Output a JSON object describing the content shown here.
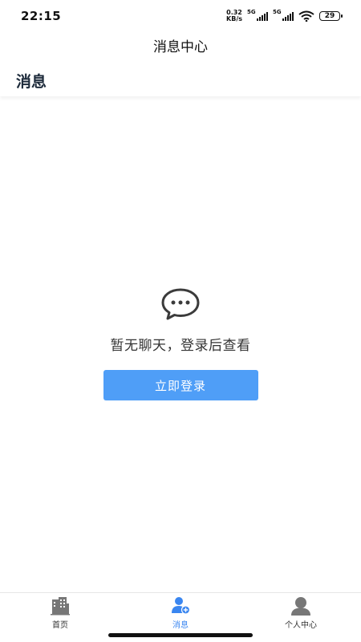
{
  "status_bar": {
    "time": "22:15",
    "net_speed_value": "0.32",
    "net_speed_unit": "KB/s",
    "sim1_label": "5G",
    "sim2_label": "5G",
    "battery": "29"
  },
  "header": {
    "title": "消息中心"
  },
  "section": {
    "title": "消息"
  },
  "empty_state": {
    "icon": "chat-bubble-icon",
    "message": "暂无聊天，登录后查看",
    "button_label": "立即登录"
  },
  "tab_bar": {
    "items": [
      {
        "label": "首页",
        "icon": "building-icon",
        "active": false
      },
      {
        "label": "消息",
        "icon": "user-add-icon",
        "active": true
      },
      {
        "label": "个人中心",
        "icon": "person-icon",
        "active": false
      }
    ]
  },
  "colors": {
    "accent": "#4f9ef7",
    "active_tab": "#3a86f0",
    "inactive_icon": "#777777"
  }
}
